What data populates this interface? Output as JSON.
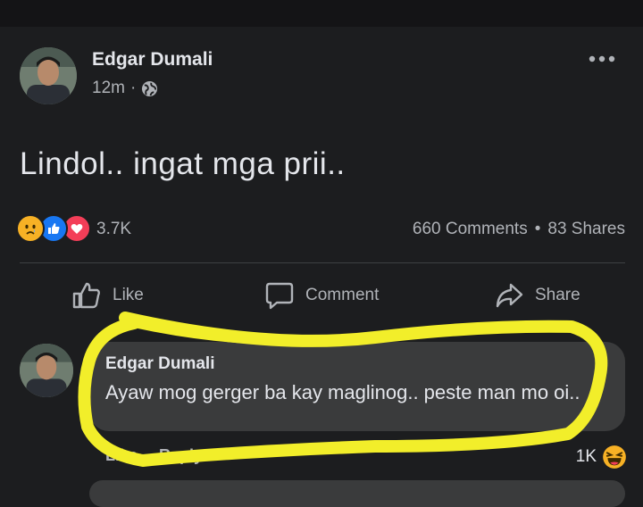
{
  "post": {
    "author": "Edgar Dumali",
    "time": "12m",
    "dot": "·",
    "text": "Lindol.. ingat mga prii..",
    "reaction_count": "3.7K",
    "comments_count": "660 Comments",
    "separator": "•",
    "shares_count": "83 Shares",
    "reactions": [
      "sad-reaction-icon",
      "like-reaction-icon",
      "love-reaction-icon"
    ]
  },
  "actions": {
    "like": "Like",
    "comment": "Comment",
    "share": "Share"
  },
  "comment": {
    "author": "Edgar Dumali",
    "text": "Ayaw mog gerger ba kay maglinog.. peste man mo oi..",
    "like": "Like",
    "reply": "Reply",
    "reaction_count": "1K",
    "reaction_icon": "haha-reaction-icon"
  },
  "colors": {
    "background": "#1c1d1f",
    "bubble": "#3a3b3c",
    "highlight": "#f2ee2a",
    "like_blue": "#1877f2",
    "love_red": "#f33e58",
    "reaction_yellow": "#f7b125"
  }
}
